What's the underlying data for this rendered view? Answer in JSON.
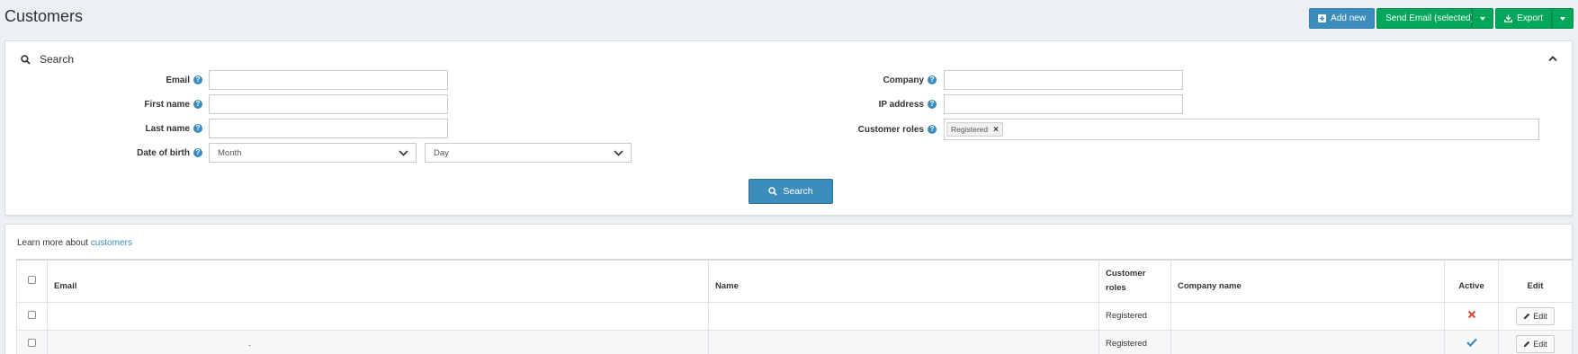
{
  "header": {
    "title": "Customers",
    "add_new": "Add new",
    "send_email": "Send Email (selected)",
    "export": "Export"
  },
  "search": {
    "title": "Search",
    "fields": {
      "email_label": "Email",
      "first_name_label": "First name",
      "last_name_label": "Last name",
      "dob_label": "Date of birth",
      "dob_month": "Month",
      "dob_day": "Day",
      "company_label": "Company",
      "ip_label": "IP address",
      "roles_label": "Customer roles",
      "roles_selected": [
        "Registered"
      ]
    },
    "button": "Search"
  },
  "list": {
    "learn_prefix": "Learn more about ",
    "learn_link": "customers",
    "columns": {
      "email": "Email",
      "name": "Name",
      "customer_roles": "Customer roles",
      "company_name": "Company name",
      "active": "Active",
      "edit": "Edit"
    },
    "rows": [
      {
        "email": "",
        "name": "",
        "roles": "Registered",
        "company": "",
        "active": false,
        "edit": "Edit"
      },
      {
        "email": ".",
        "name": "",
        "roles": "Registered",
        "company": "",
        "active": true,
        "edit": "Edit"
      }
    ]
  },
  "colors": {
    "primary": "#3c8dbc",
    "success": "#00a65a",
    "danger": "#dd4b39",
    "background": "#ecf0f5"
  }
}
